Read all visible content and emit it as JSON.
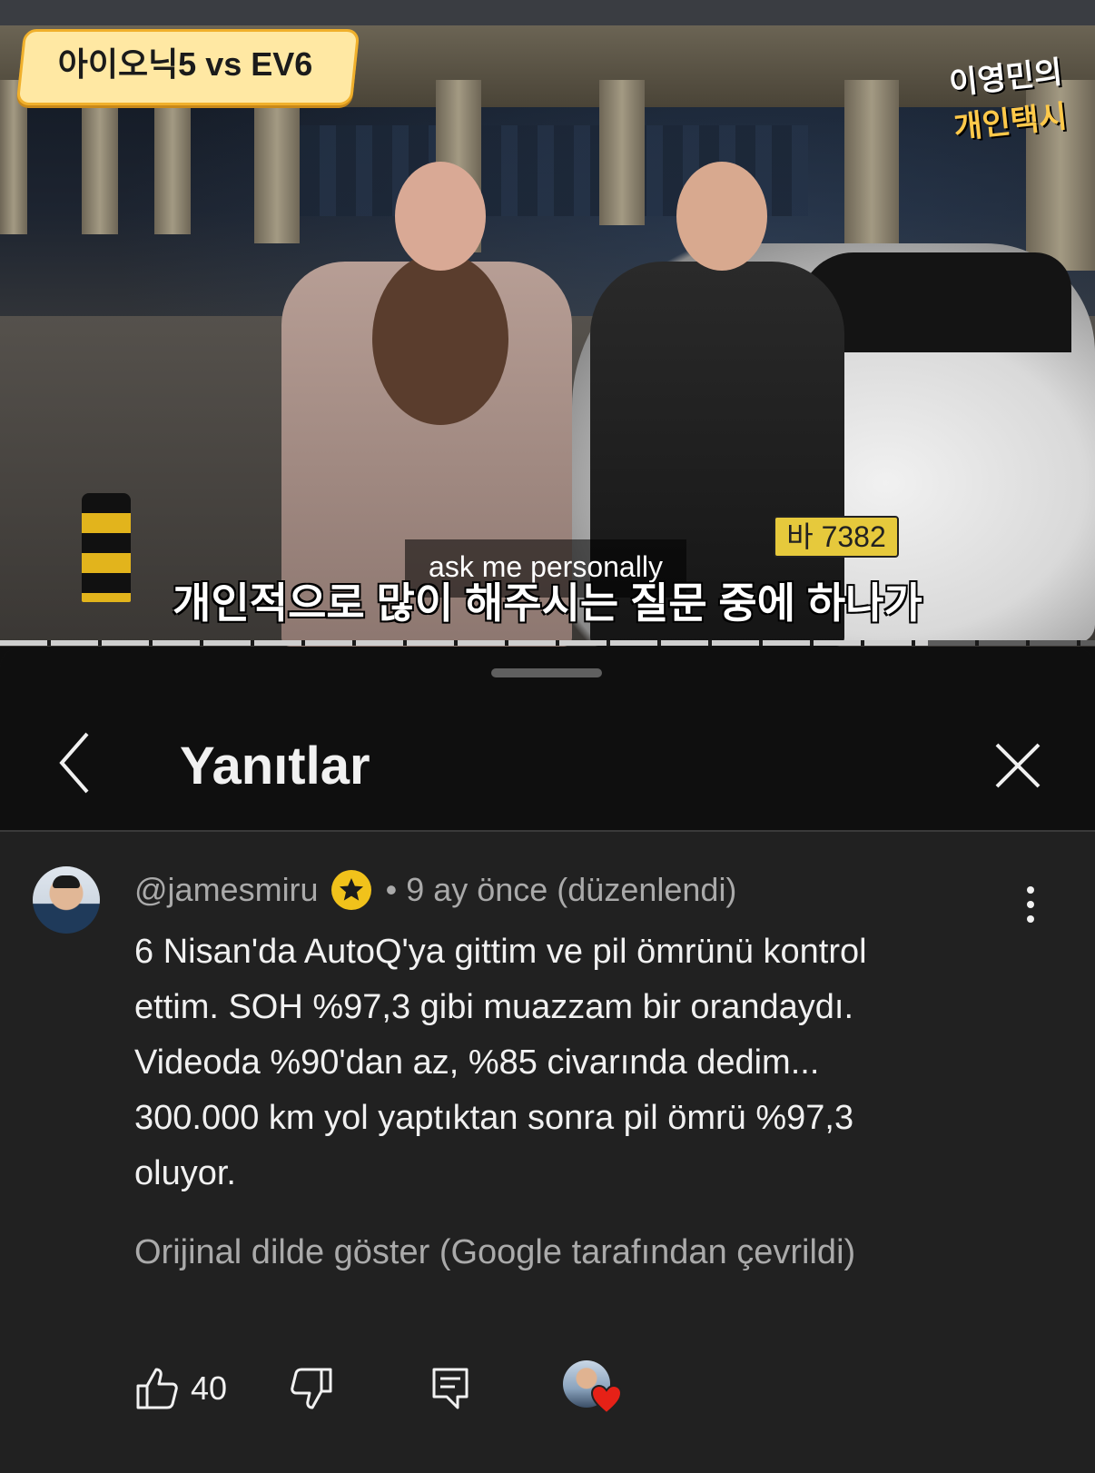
{
  "video": {
    "title_badge": "아이오닉5 vs EV6",
    "channel_logo_line1": "이영민의",
    "channel_logo_line2": "개인택시",
    "plate_text": "바 7382",
    "caption_en": "ask me personally",
    "caption_ko": "개인적으로 많이 해주시는 질문 중에 하나가"
  },
  "panel": {
    "title": "Yanıtlar",
    "back_icon": "chevron-left-icon",
    "close_icon": "close-icon"
  },
  "comment": {
    "author": "@jamesmiru",
    "badge_icon": "star-icon",
    "time": "9 ay önce (düzenlendi)",
    "separator": "•",
    "text": "6 Nisan'da AutoQ'ya gittim ve pil ömrünü kontrol\nettim. SOH %97,3 gibi muazzam bir orandaydı.\nVideoda %90'dan az, %85 civarında dedim...\n300.000 km yol yaptıktan sonra pil ömrü %97,3\noluyor.",
    "translate_link": "Orijinal dilde göster (Google tarafından çevrildi)",
    "like_count": "40",
    "colors": {
      "heart": "#e62117",
      "star": "#f1c21b",
      "text": "#f1f1f1",
      "muted": "#aaaaaa"
    }
  }
}
